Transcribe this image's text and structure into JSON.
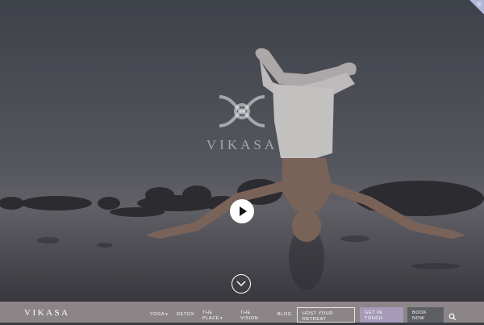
{
  "brand": {
    "name": "VIKASA"
  },
  "hero": {
    "logo_text": "VIKASA",
    "play_icon": "play-icon",
    "scroll_icon": "chevron-down-icon"
  },
  "nav": {
    "logo": "VIKASA",
    "items": [
      {
        "label": "YOGA",
        "has_dropdown": true
      },
      {
        "label": "DETOX",
        "has_dropdown": false
      },
      {
        "label": "THE",
        "label2": "PLACE",
        "has_dropdown": true
      },
      {
        "label": "THE",
        "label2": "VISION",
        "has_dropdown": false
      },
      {
        "label": "BLOG",
        "has_dropdown": false
      }
    ],
    "host_button": {
      "line1": "HOST YOUR",
      "line2": "RETREAT"
    },
    "touch_button": {
      "line1": "GET IN",
      "line2": "TOUCH"
    },
    "book_button": {
      "line1": "BOOK",
      "line2": "NOW"
    },
    "search_icon": "search-icon",
    "chevron": "▾"
  },
  "colors": {
    "nav_bg": "#8c8588",
    "get_in_touch_bg": "#a69bb8",
    "book_now_bg": "#5e5f63",
    "corner_badge": "#b0b6d6"
  }
}
